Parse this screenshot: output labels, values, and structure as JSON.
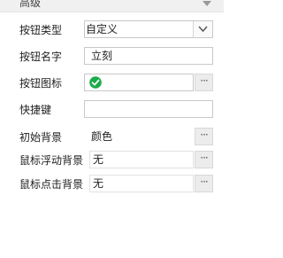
{
  "section": {
    "title": "高级"
  },
  "fields": {
    "button_type": {
      "label": "按钮类型",
      "value": "自定义"
    },
    "button_name": {
      "label": "按钮名字",
      "value": "立刻"
    },
    "button_icon": {
      "label": "按钮图标",
      "icon": "check-circle-icon",
      "more": "···"
    },
    "shortcut": {
      "label": "快捷键",
      "value": ""
    },
    "initial_bg": {
      "label": "初始背景",
      "value": "颜色",
      "more": "···"
    },
    "hover_bg": {
      "label": "鼠标浮动背景",
      "value": "无",
      "more": "···"
    },
    "click_bg": {
      "label": "鼠标点击背景",
      "value": "无",
      "more": "···"
    }
  },
  "colors": {
    "check_icon": "#1aab4a"
  }
}
